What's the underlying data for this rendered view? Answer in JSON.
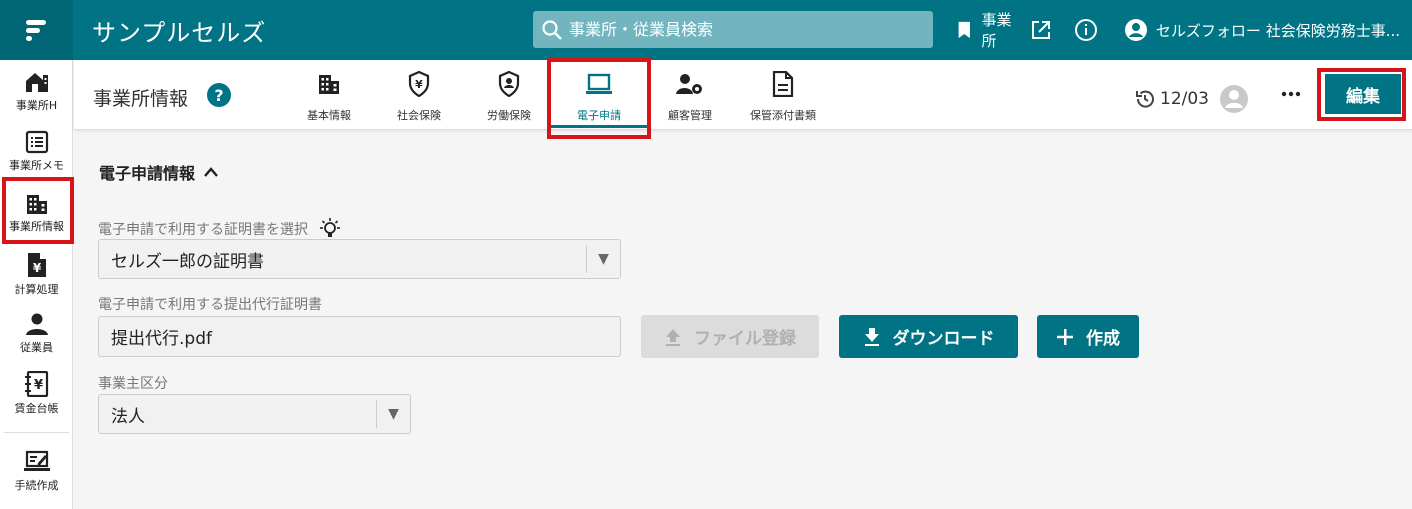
{
  "header": {
    "app_title": "サンプルセルズ",
    "search_placeholder": "事業所・従業員検索",
    "office_label": "事業所",
    "user_label": "セルズフォロー 社会保険労務士事..."
  },
  "sidebar": {
    "items": [
      {
        "label": "事業所H",
        "icon": "office-home-icon"
      },
      {
        "label": "事業所メモ",
        "icon": "memo-list-icon"
      },
      {
        "label": "事業所情報",
        "icon": "building-icon"
      },
      {
        "label": "計算処理",
        "icon": "yen-document-icon"
      },
      {
        "label": "従業員",
        "icon": "person-icon"
      },
      {
        "label": "賃金台帳",
        "icon": "yen-notebook-icon"
      },
      {
        "label": "手続作成",
        "icon": "laptop-edit-icon"
      }
    ]
  },
  "subheader": {
    "title": "事業所情報",
    "help": "?",
    "tabs": [
      {
        "label": "基本情報",
        "icon": "building-icon"
      },
      {
        "label": "社会保険",
        "icon": "yen-shield-icon"
      },
      {
        "label": "労働保険",
        "icon": "person-shield-icon"
      },
      {
        "label": "電子申請",
        "icon": "laptop-icon"
      },
      {
        "label": "顧客管理",
        "icon": "person-gear-icon"
      },
      {
        "label": "保管添付書類",
        "icon": "document-icon"
      }
    ],
    "date": "12/03",
    "edit_label": "編集"
  },
  "main": {
    "section_title": "電子申請情報",
    "cert_label": "電子申請で利用する証明書を選択",
    "cert_value": "セルズ一郎の証明書",
    "proxy_label": "電子申請で利用する提出代行証明書",
    "proxy_value": "提出代行.pdf",
    "register_label": "ファイル登録",
    "download_label": "ダウンロード",
    "create_label": "作成",
    "employer_label": "事業主区分",
    "employer_value": "法人"
  },
  "colors": {
    "brand": "#007485",
    "highlight": "#d7141a"
  }
}
